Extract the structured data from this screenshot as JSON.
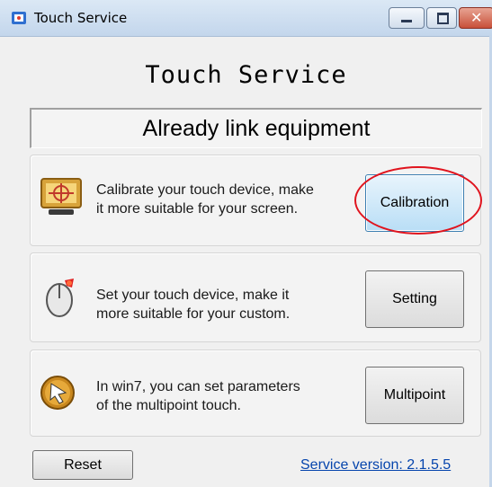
{
  "window": {
    "title": "Touch Service",
    "app_icon": "touch-service-icon",
    "controls": {
      "minimize": "minimize-icon",
      "maximize": "maximize-icon",
      "close": "close-icon",
      "close_glyph": "✕"
    }
  },
  "heading": "Touch Service",
  "status": "Already link equipment",
  "panels": [
    {
      "icon": "monitor-crosshair-icon",
      "line1": "Calibrate your touch device, make",
      "line2": "it more suitable for your screen.",
      "button": "Calibration",
      "highlighted": true
    },
    {
      "icon": "mouse-icon",
      "line1": "Set your touch device, make it",
      "line2": "more suitable for your custom.",
      "button": "Setting"
    },
    {
      "icon": "cursor-badge-icon",
      "line1": "In win7, you can set parameters",
      "line2": "of the multipoint touch.",
      "button": "Multipoint"
    }
  ],
  "footer": {
    "reset": "Reset",
    "version": "Service version: 2.1.5.5"
  },
  "colors": {
    "annotation_ellipse": "#e0141e",
    "link": "#0645ad",
    "close_button": "#c8503a"
  }
}
